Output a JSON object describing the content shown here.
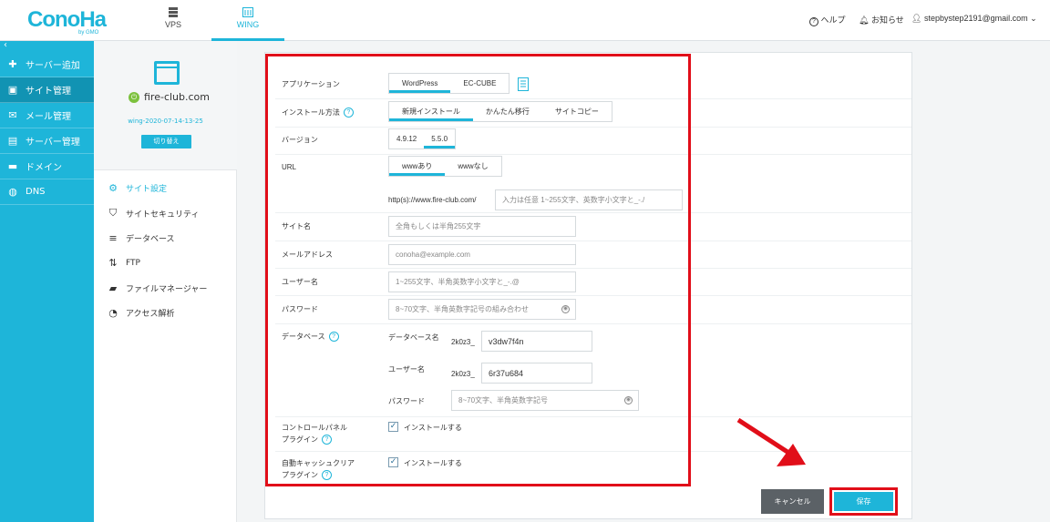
{
  "brand": {
    "logo": "ConoHa",
    "logo_sub": "by GMO"
  },
  "topnav": [
    {
      "label": "VPS",
      "icon": "server-icon"
    },
    {
      "label": "WING",
      "icon": "wing-icon",
      "active": true
    }
  ],
  "topright": {
    "help": "ヘルプ",
    "notice": "お知らせ",
    "user": "stepbystep2191@gmail.com"
  },
  "sidebar": {
    "toggle": "‹",
    "items": [
      {
        "label": "サーバー追加",
        "icon": "plus-icon"
      },
      {
        "label": "サイト管理",
        "icon": "window-icon",
        "active": true
      },
      {
        "label": "メール管理",
        "icon": "mail-icon"
      },
      {
        "label": "サーバー管理",
        "icon": "server-icon"
      },
      {
        "label": "ドメイン",
        "icon": "card-icon"
      },
      {
        "label": "DNS",
        "icon": "globe-icon"
      }
    ]
  },
  "site": {
    "domain": "fire-club.com",
    "id": "wing-2020-07-14-13-25",
    "switch_label": "切り替え"
  },
  "submenu": [
    {
      "label": "サイト設定",
      "icon": "settings-icon",
      "active": true
    },
    {
      "label": "サイトセキュリティ",
      "icon": "shield-icon"
    },
    {
      "label": "データベース",
      "icon": "database-icon"
    },
    {
      "label": "FTP",
      "icon": "transfer-icon"
    },
    {
      "label": "ファイルマネージャー",
      "icon": "folder-icon"
    },
    {
      "label": "アクセス解析",
      "icon": "pie-icon"
    }
  ],
  "form": {
    "application": {
      "label": "アプリケーション",
      "options": [
        "WordPress",
        "EC-CUBE"
      ],
      "selected": "WordPress"
    },
    "install_method": {
      "label": "インストール方法",
      "options": [
        "新規インストール",
        "かんたん移行",
        "サイトコピー"
      ],
      "selected": "新規インストール"
    },
    "version": {
      "label": "バージョン",
      "options": [
        "4.9.12",
        "5.5.0"
      ],
      "selected": "5.5.0"
    },
    "url": {
      "label": "URL",
      "options": [
        "wwwあり",
        "wwwなし"
      ],
      "selected": "wwwあり",
      "prefix": "http(s)://www.fire-club.com/",
      "placeholder": "入力は任意  1~255文字、英数字小文字と_-./"
    },
    "site_name": {
      "label": "サイト名",
      "placeholder": "全角もしくは半角255文字"
    },
    "email": {
      "label": "メールアドレス",
      "placeholder": "conoha@example.com"
    },
    "username": {
      "label": "ユーザー名",
      "placeholder": "1~255文字、半角英数字小文字と_-.@"
    },
    "password": {
      "label": "パスワード",
      "placeholder": "8~70文字、半角英数字記号の組み合わせ"
    },
    "database": {
      "label": "データベース",
      "db_name_label": "データベース名",
      "db_prefix": "2k0z3_",
      "db_name_value": "v3dw7f4n",
      "db_user_label": "ユーザー名",
      "db_user_prefix": "2k0z3_",
      "db_user_value": "6r37u684",
      "db_pass_label": "パスワード",
      "db_pass_placeholder": "8~70文字、半角英数字記号"
    },
    "control_panel_plugin": {
      "label_line1": "コントロールパネル",
      "label_line2": "プラグイン",
      "check_label": "インストールする",
      "checked": true
    },
    "cache_plugin": {
      "label_line1": "自動キャッシュクリア",
      "label_line2": "プラグイン",
      "check_label": "インストールする",
      "checked": true
    }
  },
  "buttons": {
    "cancel": "キャンセル",
    "save": "保存"
  },
  "colors": {
    "brand": "#1eb5d9",
    "highlight": "#e10e19",
    "sidebar_active": "#1193b3"
  }
}
